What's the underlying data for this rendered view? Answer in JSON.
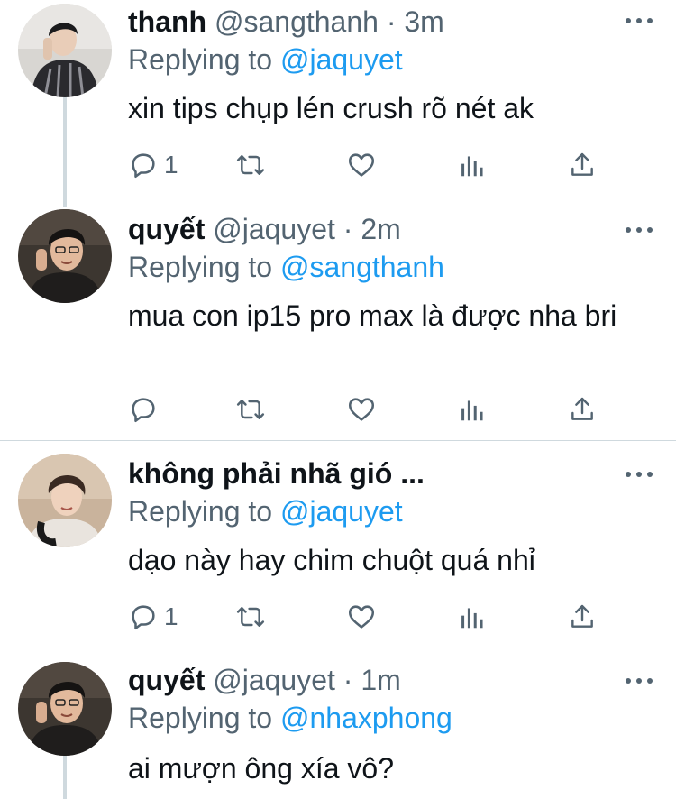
{
  "tweets": [
    {
      "name": "thanh",
      "handle": "@sangthanh",
      "dot": "·",
      "time": "3m",
      "replying_prefix": "Replying to",
      "replying_to": "@jaquyet",
      "body": "xin tips chụp lén crush rõ nét ak",
      "reply_count": "1"
    },
    {
      "name": "quyết",
      "handle": "@jaquyet",
      "dot": "·",
      "time": "2m",
      "replying_prefix": "Replying to",
      "replying_to": "@sangthanh",
      "body": "mua con ip15 pro max là được nha bri",
      "reply_count": ""
    },
    {
      "name": "không phải nhã gió ...",
      "handle": "",
      "dot": "",
      "time": "",
      "replying_prefix": "Replying to",
      "replying_to": "@jaquyet",
      "body": "dạo này hay chim chuột quá nhỉ",
      "reply_count": "1"
    },
    {
      "name": "quyết",
      "handle": "@jaquyet",
      "dot": "·",
      "time": "1m",
      "replying_prefix": "Replying to",
      "replying_to": "@nhaxphong",
      "body": "ai mượn ông xía vô?",
      "reply_count": ""
    }
  ],
  "icons": {
    "reply": "reply-icon",
    "retweet": "retweet-icon",
    "like": "heart-icon",
    "analytics": "analytics-icon",
    "share": "share-icon",
    "more": "more-icon"
  },
  "colors": {
    "accent": "#1d9bf0",
    "secondary_text": "#536471",
    "primary_text": "#0f1419",
    "divider": "#cfd9de"
  }
}
